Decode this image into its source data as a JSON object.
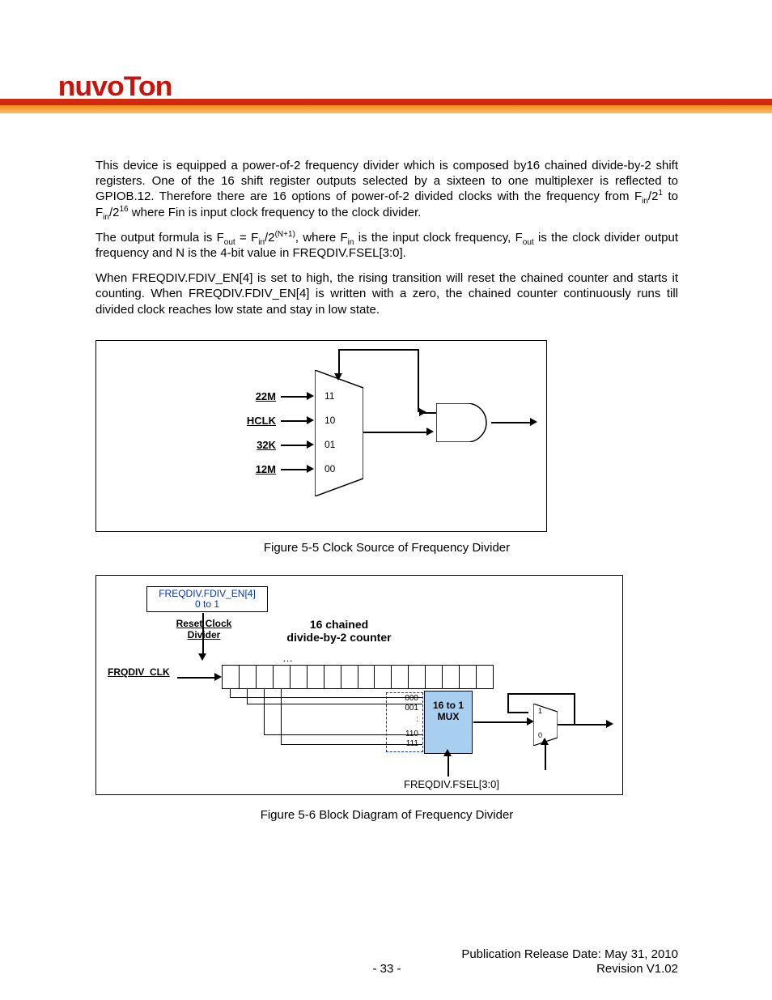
{
  "brand": {
    "logo_text": "nuvoTon"
  },
  "paragraphs": {
    "p1_a": "This device is equipped a power-of-2 frequency divider which is composed by16 chained divide-by-2 shift registers. One of the 16 shift register outputs selected by a sixteen to one multiplexer is reflected to GPIOB.12. Therefore there are 16 options of power-of-2 divided clocks with the frequency from F",
    "p1_sub1": "in",
    "p1_b": "/2",
    "p1_sup1": "1",
    "p1_c": " to F",
    "p1_sub2": "in",
    "p1_d": "/2",
    "p1_sup2": "16",
    "p1_e": " where Fin is input clock frequency to the clock divider.",
    "p2_a": "The output formula is F",
    "p2_sub1": "out",
    "p2_b": " = F",
    "p2_sub2": "in",
    "p2_c": "/2",
    "p2_sup1": "(N+1)",
    "p2_d": ", where F",
    "p2_sub3": "in",
    "p2_e": " is the input clock frequency, F",
    "p2_sub4": "out",
    "p2_f": " is the clock divider output frequency and N is the 4-bit value in FREQDIV.FSEL[3:0].",
    "p3": "When FREQDIV.FDIV_EN[4] is set to high, the rising transition will reset the chained counter and starts it counting. When FREQDIV.FDIV_EN[4] is written with a zero, the chained counter continuously runs till divided clock reaches low state and stay in low state."
  },
  "figure5": {
    "caption": "Figure 5-5 Clock Source of Frequency Divider",
    "sources": [
      "22M",
      "HCLK",
      "32K",
      "12M"
    ],
    "mux_inputs": [
      "11",
      "10",
      "01",
      "00"
    ]
  },
  "figure6": {
    "caption": "Figure 5-6 Block Diagram of Frequency Divider",
    "en_label_line1": "FREQDIV.FDIV_EN[4]",
    "en_label_line2": "0 to 1",
    "reset_label": "Reset Clock\nDivider",
    "counter_label": "16 chained\ndivide-by-2 counter",
    "clk_label": "FRQDIV_CLK",
    "dots": "…",
    "mux_inputs": [
      "000",
      "001",
      ":",
      "110",
      "111"
    ],
    "mux_label": "16 to 1\nMUX",
    "fsel_label": "FREQDIV.FSEL[3:0]",
    "small_mux": [
      "1",
      "0"
    ]
  },
  "footer": {
    "page_number": "- 33 -",
    "publication": "Publication Release Date: May 31, 2010",
    "revision": "Revision V1.02"
  }
}
